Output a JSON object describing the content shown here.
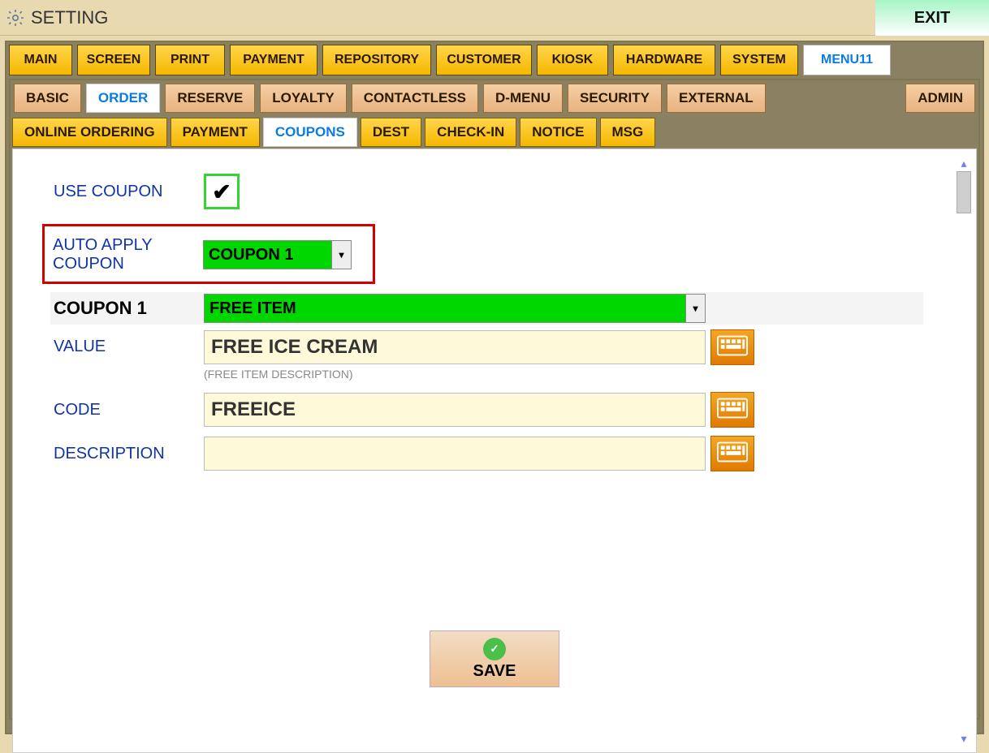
{
  "titlebar": {
    "title": "SETTING",
    "exit": "EXIT"
  },
  "tabs1": [
    {
      "label": "MAIN"
    },
    {
      "label": "SCREEN"
    },
    {
      "label": "PRINT"
    },
    {
      "label": "PAYMENT"
    },
    {
      "label": "REPOSITORY"
    },
    {
      "label": "CUSTOMER"
    },
    {
      "label": "KIOSK"
    },
    {
      "label": "HARDWARE"
    },
    {
      "label": "SYSTEM"
    },
    {
      "label": "MENU11",
      "active": true
    }
  ],
  "tabs2": [
    {
      "label": "BASIC"
    },
    {
      "label": "ORDER",
      "active": true
    },
    {
      "label": "RESERVE"
    },
    {
      "label": "LOYALTY"
    },
    {
      "label": "CONTACTLESS"
    },
    {
      "label": "D-MENU"
    },
    {
      "label": "SECURITY"
    },
    {
      "label": "EXTERNAL"
    }
  ],
  "tabs2_admin": "ADMIN",
  "tabs3": [
    {
      "label": "ONLINE ORDERING"
    },
    {
      "label": "PAYMENT"
    },
    {
      "label": "COUPONS",
      "active": true
    },
    {
      "label": "DEST"
    },
    {
      "label": "CHECK-IN"
    },
    {
      "label": "NOTICE"
    },
    {
      "label": "MSG"
    }
  ],
  "form": {
    "use_coupon_label": "USE COUPON",
    "use_coupon_checked": true,
    "auto_apply_label_l1": "AUTO APPLY",
    "auto_apply_label_l2": "COUPON",
    "auto_apply_value": "COUPON 1",
    "coupon1_label": "COUPON 1",
    "coupon1_type": "FREE ITEM",
    "value_label": "VALUE",
    "value_text": "FREE ICE CREAM",
    "value_hint": "(FREE ITEM DESCRIPTION)",
    "code_label": "CODE",
    "code_text": "FREEICE",
    "description_label": "DESCRIPTION",
    "description_text": ""
  },
  "save_label": "SAVE"
}
